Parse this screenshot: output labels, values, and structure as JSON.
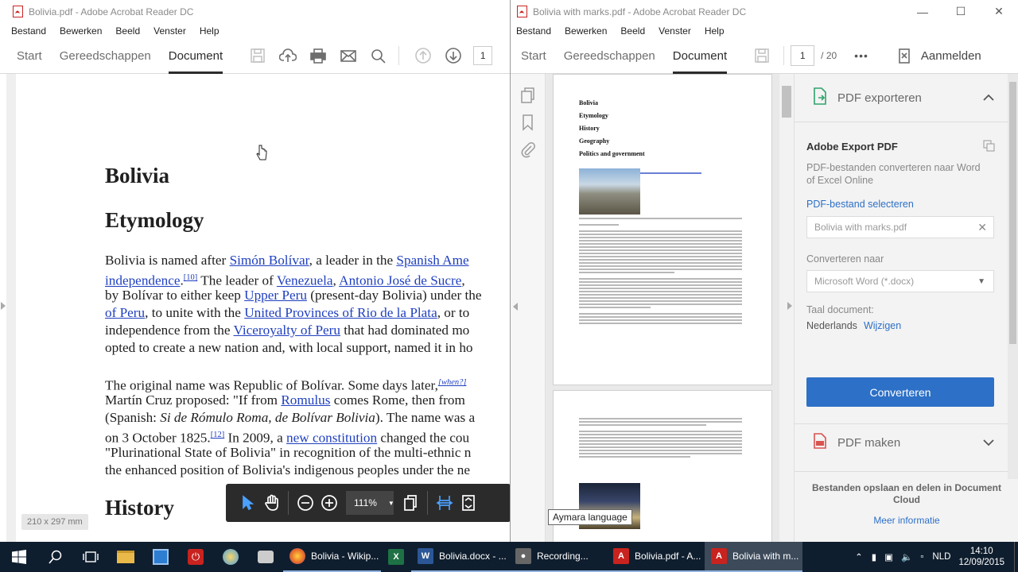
{
  "left_window": {
    "title": "Bolivia.pdf - Adobe Acrobat Reader DC",
    "menu": [
      "Bestand",
      "Bewerken",
      "Beeld",
      "Venster",
      "Help"
    ],
    "tabs": [
      "Start",
      "Gereedschappen",
      "Document"
    ],
    "page_field": "1",
    "document": {
      "h1": "Bolivia",
      "h2": "Etymology",
      "p1": [
        [
          "Bolivia is named after ",
          "Simón Bolívar",
          ", a leader in the ",
          "Spanish Ame"
        ],
        [
          "independence",
          ".",
          "[10]",
          " The leader of ",
          "Venezuela",
          ", ",
          "Antonio José de Sucre",
          ","
        ],
        [
          "by Bolívar to either keep ",
          "Upper Peru",
          " (present-day Bolivia) under the"
        ],
        [
          "of Peru",
          ", to unite with the ",
          "United Provinces of Rio de la Plata",
          ", or to"
        ],
        [
          "independence from the ",
          "Viceroyalty of Peru",
          " that had dominated mo"
        ],
        [
          "opted to create a new nation and, with local support, named it in ho"
        ]
      ],
      "p2": [
        [
          "The original name was Republic of Bolívar. Some days later,",
          "[when?]"
        ],
        [
          "Martín Cruz proposed: \"If from ",
          "Romulus",
          " comes Rome, then from "
        ],
        [
          "(Spanish: ",
          "Si de Rómulo Roma, de Bolívar Bolivia",
          "). The name was a"
        ],
        [
          "on 3 October 1825.",
          "[12]",
          " In 2009, a ",
          "new constitution",
          " changed the cou"
        ],
        [
          "\"Plurinational State of Bolivia\" in recognition of the multi-ethnic n"
        ],
        [
          "the enhanced position of Bolivia's indigenous peoples under the ne"
        ]
      ],
      "h3": "History"
    },
    "page_size": "210 x 297 mm",
    "zoom": "111%"
  },
  "right_window": {
    "title": "Bolivia with marks.pdf - Adobe Acrobat Reader DC",
    "menu": [
      "Bestand",
      "Bewerken",
      "Beeld",
      "Venster",
      "Help"
    ],
    "tabs": [
      "Start",
      "Gereedschappen",
      "Document"
    ],
    "page_current": "1",
    "page_total": "/ 20",
    "more": "•••",
    "signin": "Aanmelden",
    "thumb_headings": [
      "Bolivia",
      "Etymology",
      "History",
      "Geography",
      "Politics and government"
    ],
    "tooltip": "Aymara language",
    "panel": {
      "export_title": "PDF exporteren",
      "card_title": "Adobe Export PDF",
      "card_desc1": "PDF-bestanden converteren naar Word",
      "card_desc2": "of Excel Online",
      "select_label": "PDF-bestand selecteren",
      "file_value": "Bolivia with marks.pdf",
      "convert_to_label": "Converteren naar",
      "format_value": "Microsoft Word (*.docx)",
      "lang_label": "Taal document:",
      "lang_value": "Nederlands",
      "lang_change": "Wijzigen",
      "convert_button": "Converteren",
      "make_pdf": "PDF maken",
      "cloud_text1": "Bestanden opslaan en delen in Document",
      "cloud_text2": "Cloud",
      "more_info": "Meer informatie"
    }
  },
  "taskbar": {
    "apps": [
      {
        "label": "Bolivia - Wikip...",
        "icon": "firefox-icon",
        "color": "#e8662a"
      },
      {
        "label": "Bolivia.docx - ...",
        "icon": "word-icon",
        "color": "#2b5797"
      },
      {
        "label": "Recording...",
        "icon": "recorder-icon",
        "color": "#666"
      },
      {
        "label": "Bolivia.pdf - A...",
        "icon": "acrobat-icon",
        "color": "#c8231f"
      },
      {
        "label": "Bolivia with m...",
        "icon": "acrobat-icon",
        "color": "#c8231f"
      }
    ],
    "language": "NLD",
    "time": "14:10",
    "date": "12/09/2015"
  }
}
